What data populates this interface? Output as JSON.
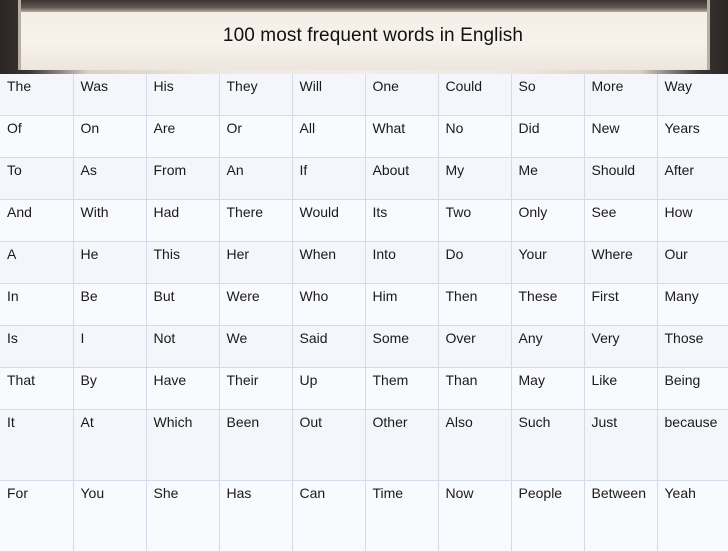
{
  "title": "100 most frequent words in English",
  "rows": [
    [
      "The",
      "Was",
      "His",
      "They",
      "Will",
      "One",
      "Could",
      "So",
      "More",
      "Way"
    ],
    [
      "Of",
      "On",
      "Are",
      "Or",
      "All",
      "What",
      "No",
      "Did",
      "New",
      "Years"
    ],
    [
      "To",
      "As",
      "From",
      "An",
      "If",
      "About",
      "My",
      "Me",
      "Should",
      "After"
    ],
    [
      "And",
      "With",
      "Had",
      "There",
      "Would",
      "Its",
      "Two",
      "Only",
      "See",
      "How"
    ],
    [
      "A",
      "He",
      "This",
      "Her",
      "When",
      "Into",
      "Do",
      "Your",
      "Where",
      "Our"
    ],
    [
      "In",
      "Be",
      "But",
      "Were",
      "Who",
      "Him",
      "Then",
      "These",
      "First",
      "Many"
    ],
    [
      "Is",
      "I",
      "Not",
      "We",
      "Said",
      "Some",
      "Over",
      "Any",
      "Very",
      "Those"
    ],
    [
      "That",
      "By",
      "Have",
      "Their",
      "Up",
      "Them",
      "Than",
      "May",
      "Like",
      "Being"
    ],
    [
      "It",
      "At",
      "Which",
      "Been",
      "Out",
      "Other",
      "Also",
      "Such",
      "Just",
      "because"
    ],
    [
      "For",
      "You",
      "She",
      "Has",
      "Can",
      "Time",
      "Now",
      "People",
      "Between",
      "Yeah"
    ]
  ]
}
